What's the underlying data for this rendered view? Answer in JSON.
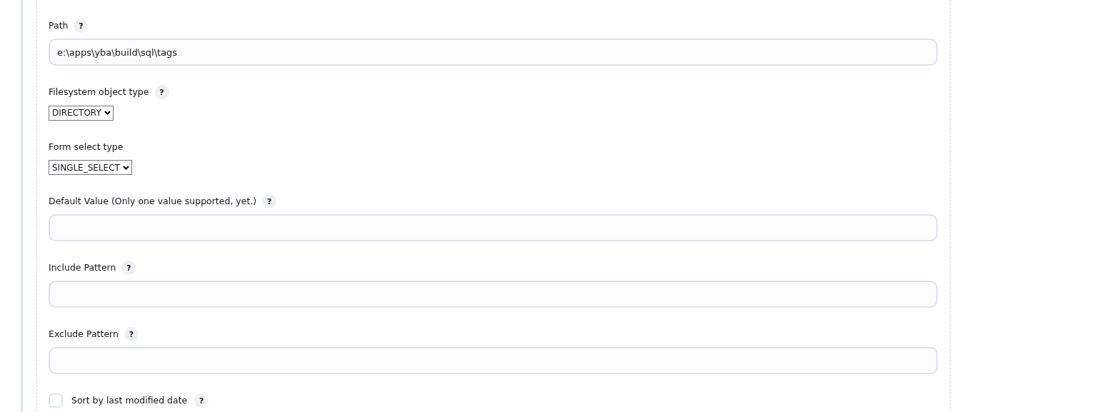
{
  "fields": [
    {
      "kind": "text",
      "label": "Path",
      "help": "?",
      "value": "e:\\apps\\yba\\build\\sql\\tags"
    },
    {
      "kind": "select",
      "label": "Filesystem object type",
      "help": "?",
      "value": "DIRECTORY"
    },
    {
      "kind": "select",
      "label": "Form select type",
      "value": "SINGLE_SELECT"
    },
    {
      "kind": "text",
      "label": "Default Value (Only one value supported, yet.)",
      "help": "?"
    },
    {
      "kind": "text",
      "label": "Include Pattern",
      "help": "?"
    },
    {
      "kind": "text",
      "label": "Exclude Pattern",
      "help": "?"
    },
    {
      "kind": "checkbox",
      "label": "Sort by last modified date",
      "help": "?",
      "checked": false
    }
  ]
}
